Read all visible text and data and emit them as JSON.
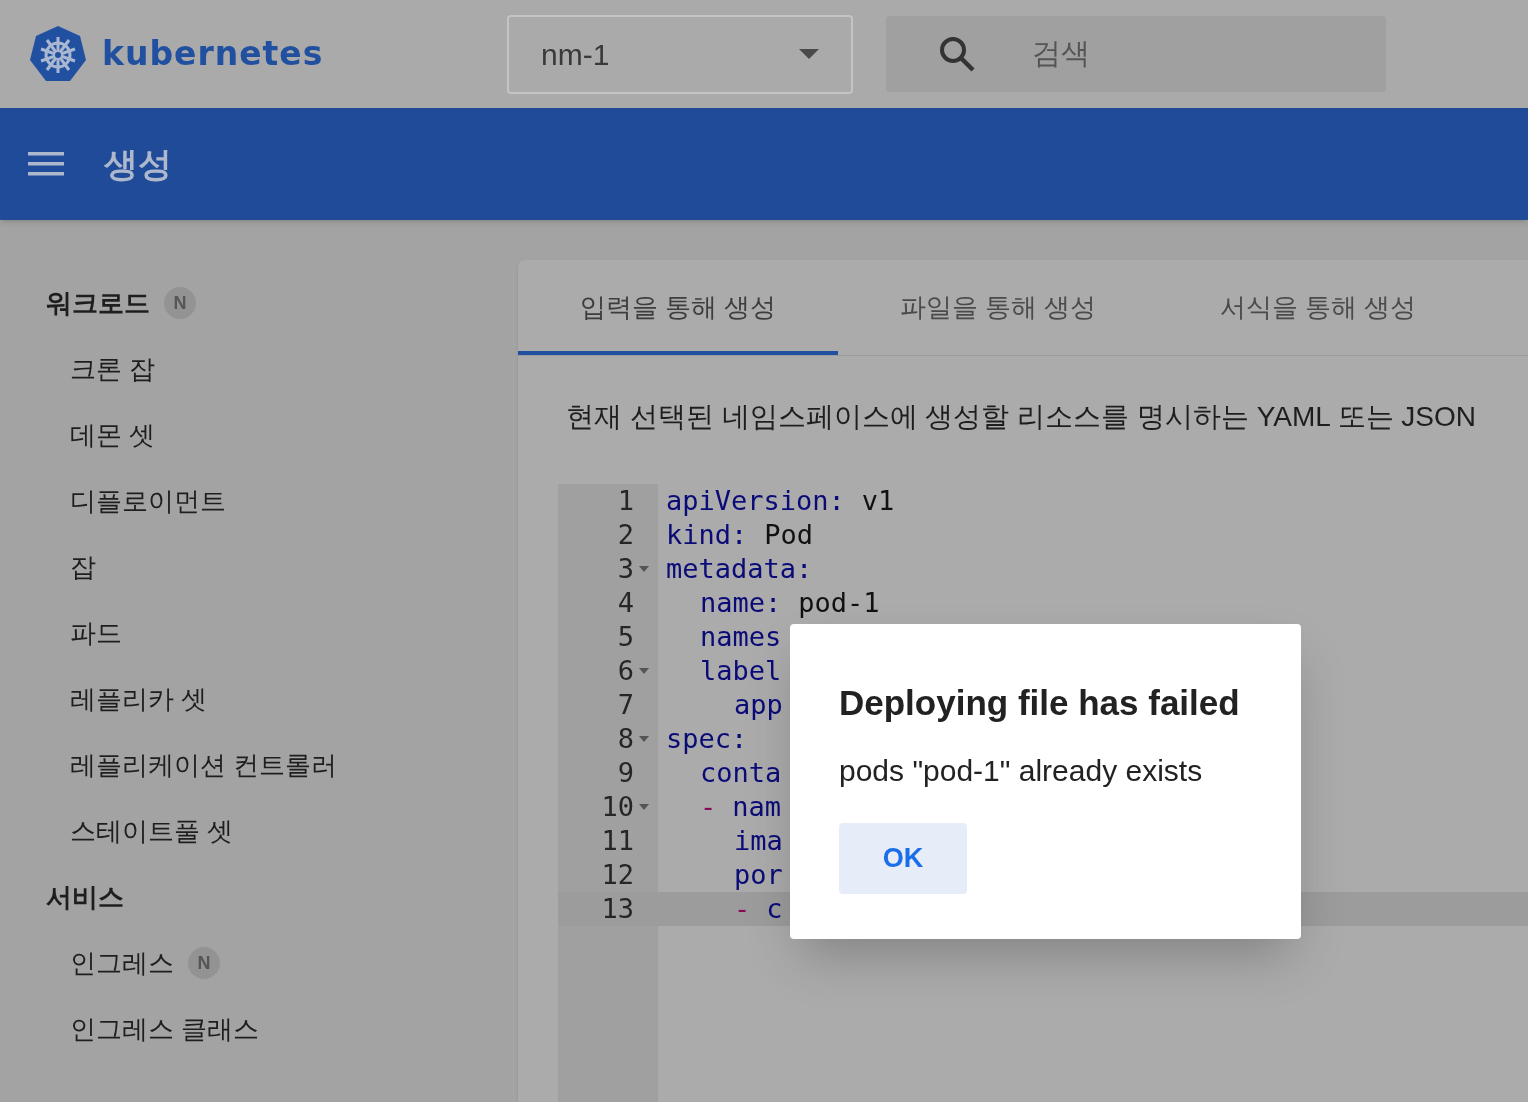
{
  "header": {
    "brand": "kubernetes",
    "namespace": "nm-1",
    "search": {
      "placeholder": "검색"
    }
  },
  "toolbar": {
    "title": "생성"
  },
  "sidebar": {
    "items": [
      {
        "kind": "section",
        "label": "워크로드",
        "badge": "N"
      },
      {
        "kind": "item",
        "label": "크론 잡"
      },
      {
        "kind": "item",
        "label": "데몬 셋"
      },
      {
        "kind": "item",
        "label": "디플로이먼트"
      },
      {
        "kind": "item",
        "label": "잡"
      },
      {
        "kind": "item",
        "label": "파드"
      },
      {
        "kind": "item",
        "label": "레플리카 셋"
      },
      {
        "kind": "item",
        "label": "레플리케이션 컨트롤러"
      },
      {
        "kind": "item",
        "label": "스테이트풀 셋"
      },
      {
        "kind": "section",
        "label": "서비스"
      },
      {
        "kind": "item",
        "label": "인그레스",
        "badge": "N"
      },
      {
        "kind": "item",
        "label": "인그레스 클래스"
      }
    ]
  },
  "tabs": [
    {
      "label": "입력을 통해 생성",
      "selected": true
    },
    {
      "label": "파일을 통해 생성",
      "selected": false
    },
    {
      "label": "서식을 통해 생성",
      "selected": false
    }
  ],
  "description": "현재 선택된 네임스페이스에 생성할 리소스를 명시하는 YAML 또는 JSON",
  "editor": {
    "lines": [
      {
        "number": "1",
        "foldable": false,
        "active": false,
        "key": "apiVersion:",
        "value": "v1"
      },
      {
        "number": "2",
        "foldable": false,
        "active": false,
        "key": "kind:",
        "value": "Pod"
      },
      {
        "number": "3",
        "foldable": true,
        "active": false,
        "key": "metadata:",
        "children": [
          {
            "number": "4",
            "foldable": false,
            "active": false,
            "key": "name:",
            "value": "pod-1"
          },
          {
            "number": "5",
            "foldable": false,
            "active": false,
            "key": "names"
          },
          {
            "number": "6",
            "foldable": true,
            "active": false,
            "key": "label",
            "children": [
              {
                "number": "7",
                "foldable": false,
                "active": false,
                "key": "app"
              }
            ]
          }
        ]
      },
      {
        "number": "8",
        "foldable": true,
        "active": false,
        "key": "spec:",
        "children": [
          {
            "number": "9",
            "foldable": false,
            "active": false,
            "key": "conta"
          },
          {
            "number": "10",
            "foldable": true,
            "active": false,
            "dash": "-",
            "key": "nam",
            "children": [
              {
                "number": "11",
                "foldable": false,
                "active": false,
                "key": "ima"
              },
              {
                "number": "12",
                "foldable": false,
                "active": false,
                "key": "por"
              },
              {
                "number": "13",
                "foldable": false,
                "active": true,
                "dash": "-",
                "key": "c"
              }
            ]
          }
        ]
      }
    ]
  },
  "dialog": {
    "title": "Deploying file has failed",
    "message": "pods \"pod-1\" already exists",
    "buttons": [
      "OK"
    ]
  }
}
